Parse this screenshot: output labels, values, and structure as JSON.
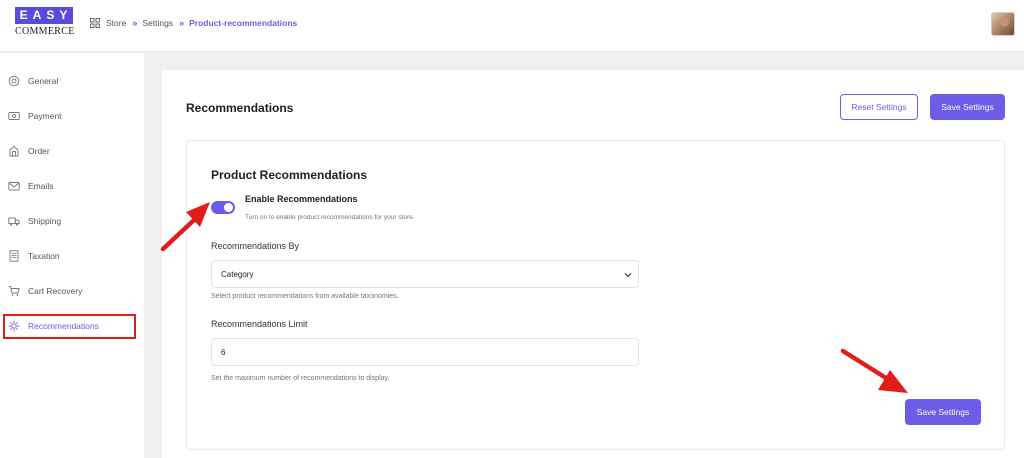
{
  "brand": {
    "logo_top": "EASY",
    "logo_bottom": "COMMERCE"
  },
  "breadcrumb": {
    "items": [
      "Store",
      "Settings"
    ],
    "current": "Product-recommendations",
    "separator": "»"
  },
  "sidebar": {
    "items": [
      {
        "label": "General",
        "icon": "gear-icon"
      },
      {
        "label": "Payment",
        "icon": "payment-icon"
      },
      {
        "label": "Order",
        "icon": "order-icon"
      },
      {
        "label": "Emails",
        "icon": "mail-icon"
      },
      {
        "label": "Shipping",
        "icon": "truck-icon"
      },
      {
        "label": "Taxation",
        "icon": "tax-icon"
      },
      {
        "label": "Cart Recovery",
        "icon": "cart-icon"
      },
      {
        "label": "Recommendations",
        "icon": "recommendations-icon"
      }
    ],
    "active": "Recommendations"
  },
  "page": {
    "title": "Recommendations",
    "reset_label": "Reset Settings",
    "save_label": "Save Settings"
  },
  "section": {
    "title": "Product Recommendations",
    "toggle": {
      "label": "Enable Recommendations",
      "help": "Turn on to enable product recommendations for your store.",
      "enabled": true
    },
    "by": {
      "label": "Recommendations By",
      "value": "Category",
      "help": "Select product recommendations from available taxonomies."
    },
    "limit": {
      "label": "Recommendations Limit",
      "value": "6",
      "help": "Set the maximum number of recommendations to display."
    }
  },
  "colors": {
    "accent": "#6c5ce7",
    "annotation": "#e31b1b"
  }
}
